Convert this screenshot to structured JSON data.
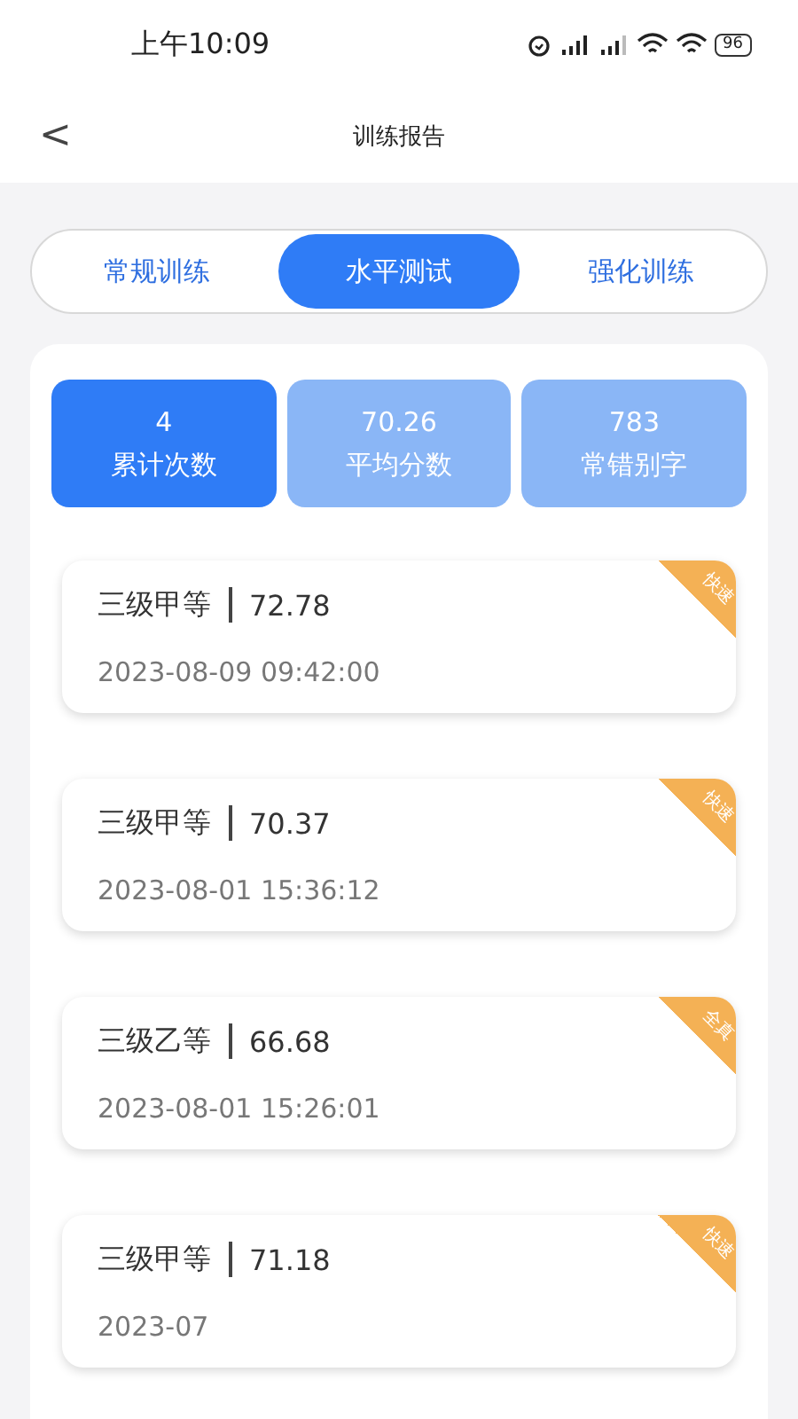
{
  "status_bar": {
    "time": "上午10:09",
    "battery": "96"
  },
  "header": {
    "back": "<",
    "title": "训练报告"
  },
  "tabs": [
    {
      "label": "常规训练",
      "selected": false
    },
    {
      "label": "水平测试",
      "selected": true
    },
    {
      "label": "强化训练",
      "selected": false
    }
  ],
  "stats": [
    {
      "value": "4",
      "label": "累计次数",
      "selected": true
    },
    {
      "value": "70.26",
      "label": "平均分数",
      "selected": false
    },
    {
      "value": "783",
      "label": "常错别字",
      "selected": false
    }
  ],
  "records": [
    {
      "level": "三级甲等",
      "score": "72.78",
      "time": "2023-08-09 09:42:00",
      "tag": "快速"
    },
    {
      "level": "三级甲等",
      "score": "70.37",
      "time": "2023-08-01 15:36:12",
      "tag": "快速"
    },
    {
      "level": "三级乙等",
      "score": "66.68",
      "time": "2023-08-01 15:26:01",
      "tag": "全真"
    },
    {
      "level": "三级甲等",
      "score": "71.18",
      "time": "2023-07",
      "tag": "快速"
    }
  ]
}
